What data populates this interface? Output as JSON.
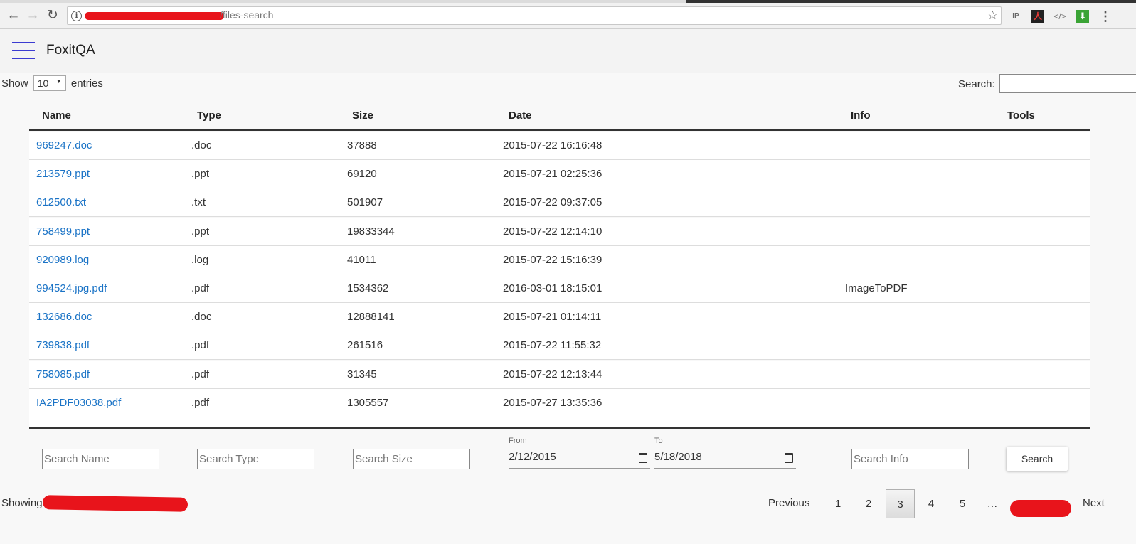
{
  "browser": {
    "url_suffix": "/files-search",
    "info_glyph": "i",
    "star_glyph": "☆",
    "extensions": [
      {
        "name": "ip-icon",
        "glyph": "IP"
      },
      {
        "name": "acrobat-icon",
        "glyph": "人"
      },
      {
        "name": "code-icon",
        "glyph": "</>"
      },
      {
        "name": "download-icon",
        "glyph": "⬇"
      },
      {
        "name": "menu-icon",
        "glyph": "⋮"
      }
    ]
  },
  "app": {
    "title": "FoxitQA"
  },
  "controls": {
    "show_label": "Show",
    "entries_value": "10",
    "entries_label": "entries",
    "search_label": "Search:"
  },
  "table": {
    "columns": [
      "Name",
      "Type",
      "Size",
      "Date",
      "Info",
      "Tools"
    ],
    "rows": [
      {
        "name": "969247.doc",
        "type": ".doc",
        "size": "37888",
        "date": "2015-07-22 16:16:48",
        "info": ""
      },
      {
        "name": "213579.ppt",
        "type": ".ppt",
        "size": "69120",
        "date": "2015-07-21 02:25:36",
        "info": ""
      },
      {
        "name": "612500.txt",
        "type": ".txt",
        "size": "501907",
        "date": "2015-07-22 09:37:05",
        "info": ""
      },
      {
        "name": "758499.ppt",
        "type": ".ppt",
        "size": "19833344",
        "date": "2015-07-22 12:14:10",
        "info": ""
      },
      {
        "name": "920989.log",
        "type": ".log",
        "size": "41011",
        "date": "2015-07-22 15:16:39",
        "info": ""
      },
      {
        "name": "994524.jpg.pdf",
        "type": ".pdf",
        "size": "1534362",
        "date": "2016-03-01 18:15:01",
        "info": "ImageToPDF"
      },
      {
        "name": "132686.doc",
        "type": ".doc",
        "size": "12888141",
        "date": "2015-07-21 01:14:11",
        "info": ""
      },
      {
        "name": "739838.pdf",
        "type": ".pdf",
        "size": "261516",
        "date": "2015-07-22 11:55:32",
        "info": ""
      },
      {
        "name": "758085.pdf",
        "type": ".pdf",
        "size": "31345",
        "date": "2015-07-22 12:13:44",
        "info": ""
      },
      {
        "name": "IA2PDF03038.pdf",
        "type": ".pdf",
        "size": "1305557",
        "date": "2015-07-27 13:35:36",
        "info": ""
      }
    ]
  },
  "filters": {
    "name_placeholder": "Search Name",
    "type_placeholder": "Search Type",
    "size_placeholder": "Search Size",
    "from_label": "From",
    "from_value": "2/12/2015",
    "to_label": "To",
    "to_value": "5/18/2018",
    "info_placeholder": "Search Info",
    "search_button": "Search"
  },
  "footer": {
    "showing_label": "Showing",
    "previous": "Previous",
    "pages": [
      "1",
      "2",
      "3",
      "4",
      "5"
    ],
    "current_page": "3",
    "ellipsis": "…",
    "next": "Next"
  }
}
